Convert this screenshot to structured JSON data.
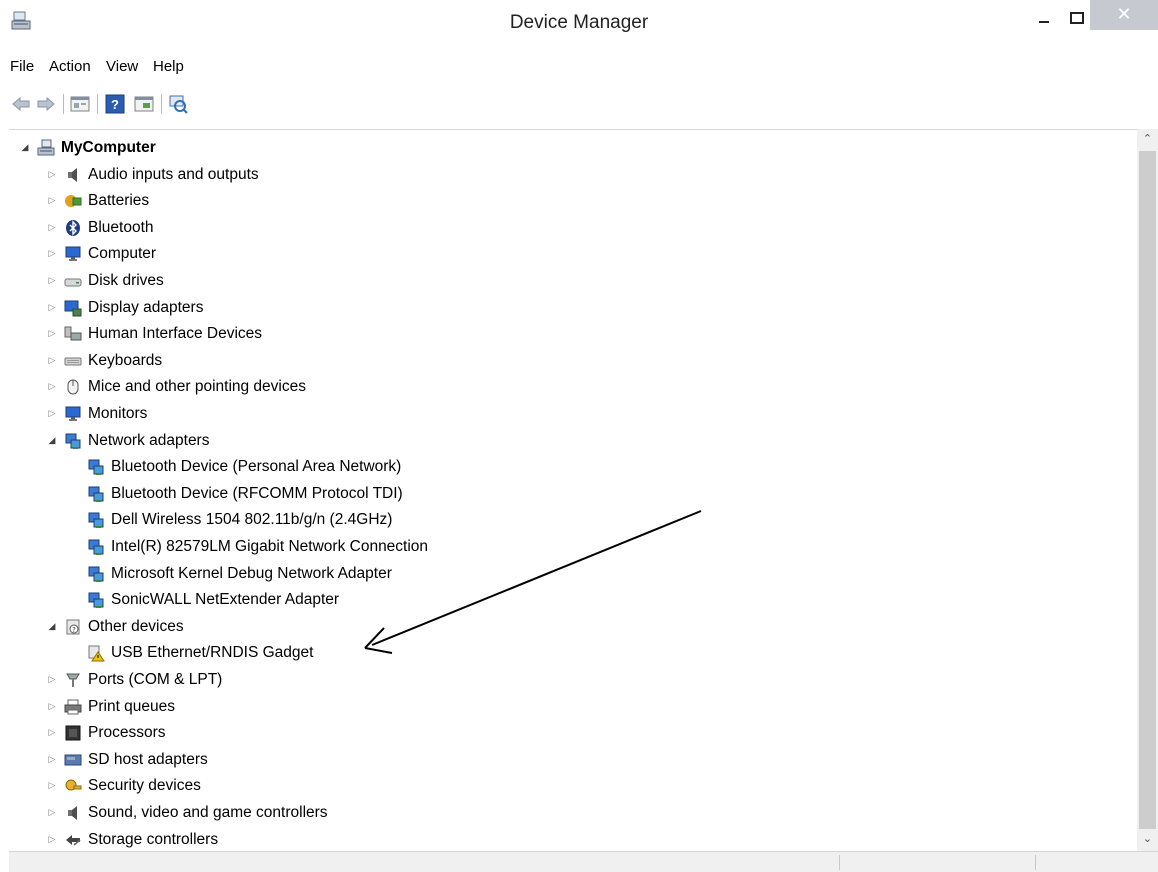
{
  "window": {
    "title": "Device Manager",
    "close_glyph": "✕"
  },
  "menu": {
    "items": [
      "File",
      "Action",
      "View",
      "Help"
    ]
  },
  "toolbar": {
    "buttons": [
      "back-icon",
      "forward-icon",
      "properties-icon",
      "help-icon",
      "update-driver-icon",
      "scan-hardware-icon"
    ]
  },
  "tree": {
    "root": {
      "label": "MyComputer",
      "icon": "computer-icon"
    },
    "categories": [
      {
        "label": "Audio inputs and outputs",
        "icon": "speaker-icon"
      },
      {
        "label": "Batteries",
        "icon": "battery-icon"
      },
      {
        "label": "Bluetooth",
        "icon": "bluetooth-icon"
      },
      {
        "label": "Computer",
        "icon": "monitor-icon"
      },
      {
        "label": "Disk drives",
        "icon": "disk-drive-icon"
      },
      {
        "label": "Display adapters",
        "icon": "display-adapter-icon"
      },
      {
        "label": "Human Interface Devices",
        "icon": "hid-icon"
      },
      {
        "label": "Keyboards",
        "icon": "keyboard-icon"
      },
      {
        "label": "Mice and other pointing devices",
        "icon": "mouse-icon"
      },
      {
        "label": "Monitors",
        "icon": "monitor-icon"
      },
      {
        "label": "Network adapters",
        "icon": "network-adapter-icon"
      },
      {
        "label": "Bluetooth Device (Personal Area Network)",
        "icon": "network-adapter-icon"
      },
      {
        "label": "Bluetooth Device (RFCOMM Protocol TDI)",
        "icon": "network-adapter-icon"
      },
      {
        "label": "Dell Wireless 1504 802.11b/g/n (2.4GHz)",
        "icon": "network-adapter-icon"
      },
      {
        "label": "Intel(R) 82579LM Gigabit Network Connection",
        "icon": "network-adapter-icon"
      },
      {
        "label": "Microsoft Kernel Debug Network Adapter",
        "icon": "network-adapter-icon"
      },
      {
        "label": "SonicWALL NetExtender Adapter",
        "icon": "network-adapter-icon"
      },
      {
        "label": "Other devices",
        "icon": "unknown-device-icon"
      },
      {
        "label": "USB Ethernet/RNDIS Gadget",
        "icon": "warning-device-icon"
      },
      {
        "label": "Ports (COM & LPT)",
        "icon": "port-icon"
      },
      {
        "label": "Print queues",
        "icon": "printer-icon"
      },
      {
        "label": "Processors",
        "icon": "processor-icon"
      },
      {
        "label": "SD host adapters",
        "icon": "sd-card-icon"
      },
      {
        "label": "Security devices",
        "icon": "security-key-icon"
      },
      {
        "label": "Sound, video and game controllers",
        "icon": "speaker-icon"
      },
      {
        "label": "Storage controllers",
        "icon": "storage-controller-icon"
      }
    ]
  },
  "scrollbar": {
    "up_glyph": "⌃",
    "down_glyph": "⌄"
  },
  "colors": {
    "close_button": "#c7c9d1",
    "warning": "#f2c200",
    "network_blue": "#3a7bd5"
  }
}
